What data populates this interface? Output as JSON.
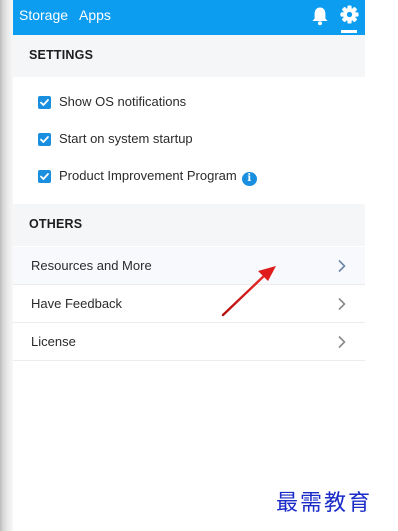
{
  "topbar": {
    "storage_label": "Storage",
    "apps_label": "Apps",
    "bell_icon": "bell-icon",
    "gear_icon": "gear-icon",
    "background_color": "#0c9cf0"
  },
  "settings": {
    "heading": "SETTINGS",
    "items": [
      {
        "label": "Show OS notifications",
        "checked": true
      },
      {
        "label": "Start on system startup",
        "checked": true
      },
      {
        "label": "Product Improvement Program",
        "checked": true,
        "info_icon": "info-icon"
      }
    ],
    "info_glyph": "i"
  },
  "others": {
    "heading": "OTHERS",
    "items": [
      {
        "label": "Resources and More",
        "icon": "chevron-right-icon"
      },
      {
        "label": "Have Feedback",
        "icon": "chevron-right-icon"
      },
      {
        "label": "License",
        "icon": "chevron-right-icon"
      }
    ]
  },
  "annotation": {
    "arrow_color": "#e01b1b"
  },
  "watermark": {
    "text": "最需教育"
  },
  "colors": {
    "accent": "#1a8fe0",
    "section_bg": "#f5f6f8"
  }
}
